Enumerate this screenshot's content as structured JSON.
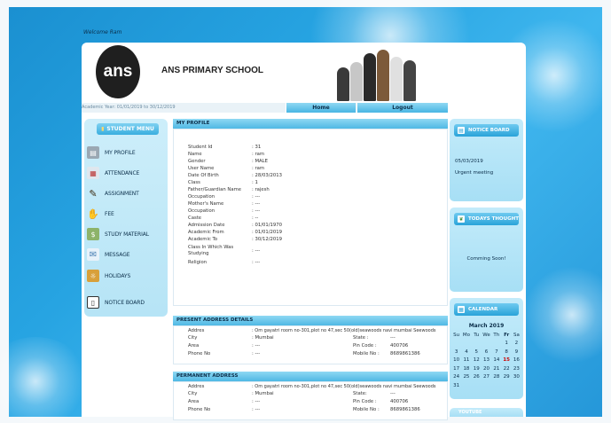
{
  "welcome": "Welcome Ram",
  "school": {
    "logo_text": "ans",
    "name": "ANS PRIMARY SCHOOL"
  },
  "academic_year": "Academic Year: 01/01/2019 to 30/12/2019",
  "nav": {
    "home": "Home",
    "logout": "Logout"
  },
  "sidebar": {
    "title": "STUDENT MENU",
    "items": [
      {
        "label": "MY PROFILE",
        "icon": "profile-icon"
      },
      {
        "label": "ATTENDANCE",
        "icon": "calendar-icon"
      },
      {
        "label": "ASSIGNMENT",
        "icon": "pencil-icon"
      },
      {
        "label": "FEE",
        "icon": "hand-icon"
      },
      {
        "label": "STUDY MATERIAL",
        "icon": "money-icon"
      },
      {
        "label": "MESSAGE",
        "icon": "envelope-icon"
      },
      {
        "label": "HOLIDAYS",
        "icon": "holiday-icon"
      },
      {
        "label": "NOTICE BOARD",
        "icon": "clipboard-icon"
      }
    ]
  },
  "profile": {
    "title": "MY PROFILE",
    "fields": [
      {
        "label": "Student Id",
        "value": ": 31"
      },
      {
        "label": "Name",
        "value": ": ram"
      },
      {
        "label": "Gender",
        "value": ": MALE"
      },
      {
        "label": "User Name",
        "value": ": ram"
      },
      {
        "label": "Date Of Birth",
        "value": ": 28/03/2013"
      },
      {
        "label": "Class",
        "value": ": 1"
      },
      {
        "label": "Father/Guardian Name",
        "value": ": rajesh"
      },
      {
        "label": "Occupation",
        "value": ": ---"
      },
      {
        "label": "Mother's Name",
        "value": ": ---"
      },
      {
        "label": "Occupation",
        "value": ": ---"
      },
      {
        "label": "Caste",
        "value": ": --"
      },
      {
        "label": "Admission Date",
        "value": ": 01/01/1970"
      },
      {
        "label": "Academic From",
        "value": ": 01/01/2019"
      },
      {
        "label": "Academic To",
        "value": ": 30/12/2019"
      },
      {
        "label": "Class In Which Was",
        "label2": "Studying",
        "value": ": ---"
      },
      {
        "label": "Religion",
        "value": ": ---"
      }
    ]
  },
  "present_address": {
    "title": "PRESENT ADDRESS DETAILS",
    "address_label": "Addres",
    "address_value": ": Om gayatri room no-301,plot no 47,sec 50(old)seawoods navi mumbai Seewoods",
    "city_label": "City",
    "city_value": ": Mumbai",
    "state_label": "State :",
    "state_value": "---",
    "area_label": "Area",
    "area_value": ": ---",
    "pin_label": "Pin Code :",
    "pin_value": "400706",
    "phone_label": "Phone No",
    "phone_value": ": ---",
    "mobile_label": "Mobile No :",
    "mobile_value": "8689861386"
  },
  "permanent_address": {
    "title": "PERMANENT ADDRESS",
    "address_label": "Addres",
    "address_value": ": Om gayatri room no-301,plot no 47,sec 50(old)seawoods navi mumbai Seewoods",
    "city_label": "City",
    "city_value": ": Mumbai",
    "state_label": "State:",
    "state_value": "---",
    "area_label": "Area",
    "area_value": ": ---",
    "pin_label": "Pin Code :",
    "pin_value": "400706",
    "phone_label": "Phone No",
    "phone_value": ": ---",
    "mobile_label": "Mobile No :",
    "mobile_value": "8689861386"
  },
  "notice_board": {
    "title": "NOTICE BOARD",
    "date": "05/03/2019",
    "text": "Urgent meeting"
  },
  "todays_thought": {
    "title": "TODAYS THOUGHT",
    "text": "Comming Soon!"
  },
  "calendar": {
    "title": "CALENDAR",
    "month": "March 2019",
    "days": [
      "Su",
      "Mo",
      "Tu",
      "We",
      "Th",
      "Fr",
      "Sa"
    ],
    "weeks": [
      [
        "",
        "",
        "",
        "",
        "",
        "1",
        "2"
      ],
      [
        "3",
        "4",
        "5",
        "6",
        "7",
        "8",
        "9"
      ],
      [
        "10",
        "11",
        "12",
        "13",
        "14",
        "15",
        "16"
      ],
      [
        "17",
        "18",
        "19",
        "20",
        "21",
        "22",
        "23"
      ],
      [
        "24",
        "25",
        "26",
        "27",
        "28",
        "29",
        "30"
      ],
      [
        "31",
        "",
        "",
        "",
        "",
        "",
        ""
      ]
    ],
    "today": "15"
  },
  "partial_panel": {
    "title": "YOUTUBE"
  },
  "colors": {
    "accent": "#3aaedf",
    "header": "#8fd8f3",
    "sidebar": "#cdeefa",
    "background": "#1a8fd0"
  }
}
